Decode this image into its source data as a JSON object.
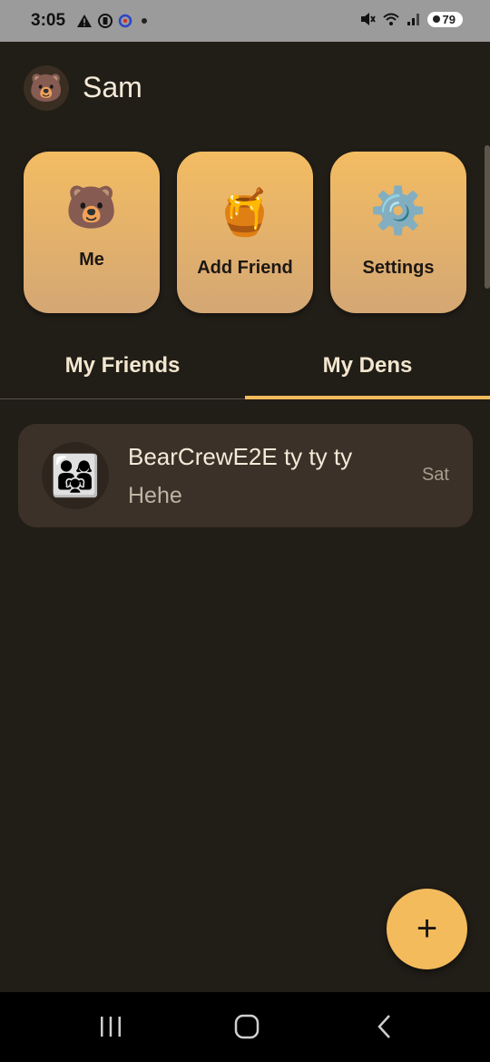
{
  "status_bar": {
    "time": "3:05",
    "left_icons": [
      "warning-icon",
      "recording-icon",
      "app-icon",
      "dot-icon"
    ],
    "right_icons": [
      "mute-icon",
      "wifi-icon",
      "signal-icon"
    ],
    "battery": "79"
  },
  "header": {
    "avatar_emoji": "🐻",
    "username": "Sam"
  },
  "actions": [
    {
      "emoji": "🐻",
      "label": "Me"
    },
    {
      "emoji": "🍯",
      "label": "Add Friend"
    },
    {
      "emoji": "⚙️",
      "label": "Settings"
    }
  ],
  "tabs": [
    {
      "label": "My Friends",
      "selected": false
    },
    {
      "label": "My Dens",
      "selected": true
    }
  ],
  "dens": [
    {
      "avatar_emoji": "👨‍👩‍👧",
      "name": "BearCrewE2E ty ty ty",
      "last_message": "Hehe",
      "time": "Sat"
    }
  ],
  "fab": {
    "label": "+"
  },
  "colors": {
    "background": "#211d17",
    "accent": "#f3bb5c",
    "card_gradient_top": "#f3bc62",
    "card_gradient_bottom": "#d4a774",
    "list_item": "#3b3128"
  },
  "nav_bar": {
    "icons": [
      "recent-apps-icon",
      "home-icon",
      "back-icon"
    ]
  }
}
